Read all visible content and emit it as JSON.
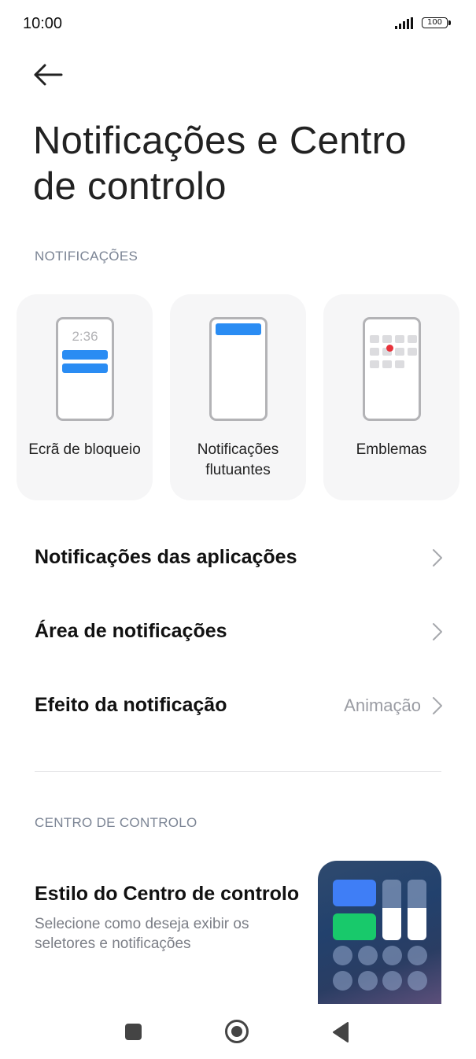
{
  "status_bar": {
    "time": "10:00",
    "battery": "100",
    "icons": [
      "signal-icon",
      "battery-icon"
    ]
  },
  "header": {
    "back_icon": "arrow-left-icon",
    "title": "Notificações e Centro de controlo"
  },
  "notifications_section": {
    "header": "NOTIFICAÇÕES",
    "cards": [
      {
        "label": "Ecrã de bloqueio",
        "illustration_time": "2:36"
      },
      {
        "label": "Notificações flutuantes"
      },
      {
        "label": "Emblemas"
      }
    ],
    "rows": [
      {
        "label": "Notificações das aplicações",
        "value": ""
      },
      {
        "label": "Área de notificações",
        "value": ""
      },
      {
        "label": "Efeito da notificação",
        "value": "Animação"
      }
    ]
  },
  "control_center_section": {
    "header": "CENTRO DE CONTROLO",
    "style_item": {
      "title": "Estilo do Centro de controlo",
      "description": "Selecione como deseja exibir os seletores e notificações"
    }
  },
  "colors": {
    "accent_blue": "#2a8cf3",
    "badge_red": "#e8323b",
    "tile_blue": "#3f7ef6",
    "tile_green": "#18c96b"
  },
  "nav_bar": {
    "icons": [
      "square-recents-icon",
      "circle-home-icon",
      "triangle-back-icon"
    ]
  }
}
